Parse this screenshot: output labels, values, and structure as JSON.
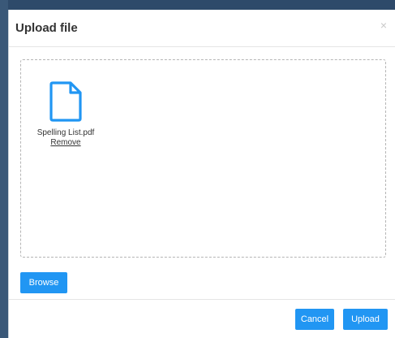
{
  "modal": {
    "title": "Upload file",
    "close_glyph": "×"
  },
  "dropzone": {
    "files": [
      {
        "name": "Spelling List.pdf",
        "remove_label": "Remove",
        "icon": "document-icon"
      }
    ]
  },
  "actions": {
    "browse_label": "Browse",
    "cancel_label": "Cancel",
    "upload_label": "Upload"
  },
  "colors": {
    "accent": "#2196f3",
    "backdrop": "#2e4a6a"
  }
}
